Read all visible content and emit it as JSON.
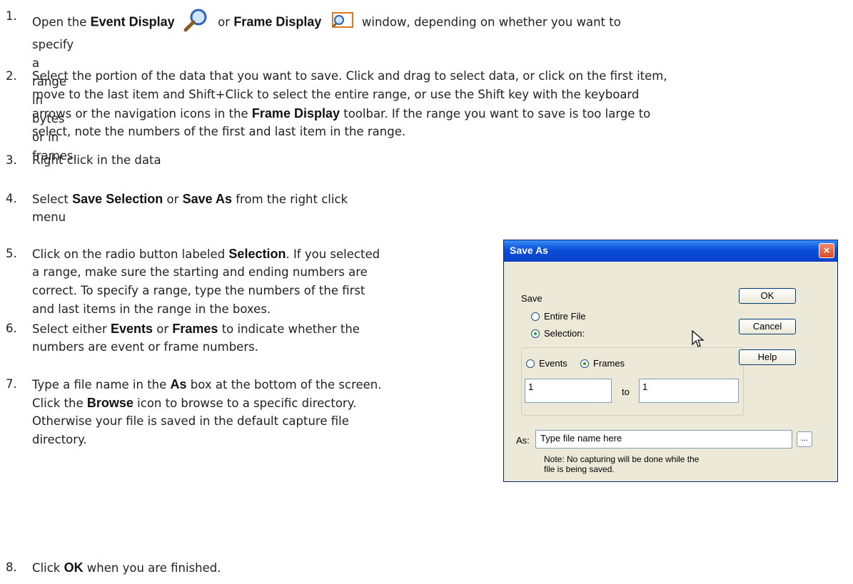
{
  "steps": [
    {
      "num": "1.",
      "pre": "Open the ",
      "k1": "Event Display",
      "mid": " or ",
      "k2": "Frame Display",
      "post": " window, depending on whether you want to",
      "line2": "specify a range in bytes or in frames."
    },
    {
      "num": "2.",
      "l1": "Select the portion of the data that you want to save. Click and drag to select data, or click on the first item,",
      "l2": "move to the last item and Shift+Click to select the entire range, or use the Shift key with the keyboard",
      "l3pre": "arrows or the navigation icons in the ",
      "l3k": "Frame Display",
      "l3post": " toolbar. If the range you want to save is too large to",
      "l4": "select, note the numbers of the first and last item in the range."
    },
    {
      "num": "3.",
      "l1": "Right click in the data"
    },
    {
      "num": "4.",
      "pre": "Select ",
      "k1": "Save Selection",
      "mid": " or ",
      "k2": "Save As",
      "post": " from the right click",
      "l2": "menu"
    },
    {
      "num": "5.",
      "pre": "Click on the radio button labeled ",
      "k1": "Selection",
      "post": ". If you selected",
      "l2": "a range, make sure the starting and ending numbers are",
      "l3": "correct. To specify a range, type the numbers of the first",
      "l4": "and last items in the range in the boxes."
    },
    {
      "num": "6.",
      "pre": "Select either ",
      "k1": "Events",
      "mid": " or ",
      "k2": "Frames",
      "post": " to indicate whether the",
      "l2": "numbers are event or frame numbers."
    },
    {
      "num": "7.",
      "pre": "Type a file name in the ",
      "k1": "As",
      "post": " box at the bottom of the screen.",
      "l2pre": "Click the ",
      "l2k": "Browse",
      "l2post": " icon to browse to a specific directory.",
      "l3": "Otherwise your file is saved in the default capture file",
      "l4": "directory."
    },
    {
      "num": "8.",
      "pre": "Click ",
      "k1": "OK",
      "post": " when you are finished."
    }
  ],
  "dialog": {
    "title": "Save As",
    "close": "×",
    "save_group": "Save",
    "entire_file": "Entire File",
    "selection": "Selection:",
    "events": "Events",
    "frames": "Frames",
    "from_value": "1",
    "to_label": "to",
    "to_value": "1",
    "as_label": "As:",
    "as_value": "Type file name here",
    "browse": "...",
    "note_l1": "Note: No capturing will be done while the",
    "note_l2": "file is being saved.",
    "ok": "OK",
    "cancel": "Cancel",
    "help": "Help"
  },
  "icons": {
    "event_display": "magnifier-icon",
    "frame_display": "frame-display-icon",
    "cursor": "mouse-pointer-icon"
  },
  "colors": {
    "titlebar": "#0a4ed8",
    "dialog_bg": "#ece9d8",
    "close": "#d94a26"
  }
}
